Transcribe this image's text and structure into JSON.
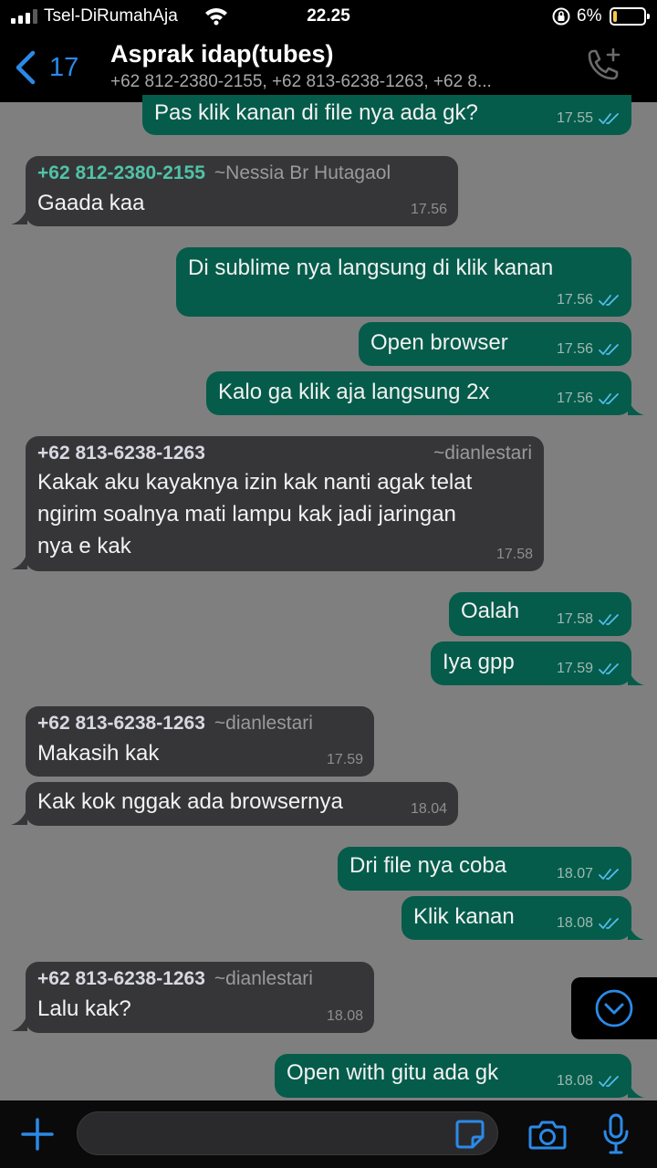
{
  "status_bar": {
    "carrier": "Tsel-DiRumahAja",
    "time": "22.25",
    "battery_percent": "6%",
    "battery_level": 0.06
  },
  "header": {
    "back_count": "17",
    "title": "Asprak idap(tubes)",
    "subtitle": "+62 812-2380-2155, +62 813-6238-1263, +62 8...",
    "icons": {
      "back": "chevron-left-icon",
      "call": "add-call-icon"
    }
  },
  "messages": [
    {
      "id": "m1",
      "direction": "out",
      "text": "Pas klik kanan di file nya ada gk?",
      "time": "17.55",
      "read": true
    },
    {
      "id": "m2",
      "direction": "in",
      "sender_number": "+62 812-2380-2155",
      "sender_alias": "~Nessia Br Hutagaol",
      "sender_color": "#4fc3a7",
      "text": "Gaada kaa",
      "time": "17.56"
    },
    {
      "id": "m3",
      "direction": "out",
      "text": "Di sublime nya langsung di klik kanan",
      "time": "17.56",
      "read": true
    },
    {
      "id": "m4",
      "direction": "out",
      "text": "Open browser",
      "time": "17.56",
      "read": true
    },
    {
      "id": "m5",
      "direction": "out",
      "text": "Kalo ga klik aja langsung 2x",
      "time": "17.56",
      "read": true
    },
    {
      "id": "m6",
      "direction": "in",
      "sender_number": "+62 813-6238-1263",
      "sender_alias": "~dianlestari",
      "sender_color": "#d8d8e2",
      "lines": [
        "Kakak aku kayaknya izin kak nanti agak telat",
        "ngirim soalnya mati lampu kak jadi jaringan",
        "nya e kak"
      ],
      "time": "17.58"
    },
    {
      "id": "m7",
      "direction": "out",
      "text": "Oalah",
      "time": "17.58",
      "read": true
    },
    {
      "id": "m8",
      "direction": "out",
      "text": "Iya gpp",
      "time": "17.59",
      "read": true
    },
    {
      "id": "m9",
      "direction": "in",
      "sender_number": "+62 813-6238-1263",
      "sender_alias": "~dianlestari",
      "sender_color": "#d8d8e2",
      "text": "Makasih kak",
      "time": "17.59"
    },
    {
      "id": "m10",
      "direction": "in",
      "text": "Kak kok nggak ada browsernya",
      "time": "18.04"
    },
    {
      "id": "m11",
      "direction": "out",
      "text": "Dri file nya coba",
      "time": "18.07",
      "read": true
    },
    {
      "id": "m12",
      "direction": "out",
      "text": "Klik kanan",
      "time": "18.08",
      "read": true
    },
    {
      "id": "m13",
      "direction": "in",
      "sender_number": "+62 813-6238-1263",
      "sender_alias": "~dianlestari",
      "sender_color": "#d8d8e2",
      "text": "Lalu kak?",
      "time": "18.08"
    },
    {
      "id": "m14",
      "direction": "out",
      "text": "Open with gitu ada gk",
      "time": "18.08",
      "read": true
    }
  ],
  "input_bar": {
    "placeholder": "",
    "icons": {
      "attach": "plus-icon",
      "sticker": "sticker-icon",
      "camera": "camera-icon",
      "mic": "microphone-icon"
    }
  },
  "colors": {
    "background": "#7f7f7f",
    "outgoing_bubble": "#055c4b",
    "incoming_bubble": "#363638",
    "accent_blue": "#2b8ae8",
    "read_ticks": "#53bdeb"
  }
}
